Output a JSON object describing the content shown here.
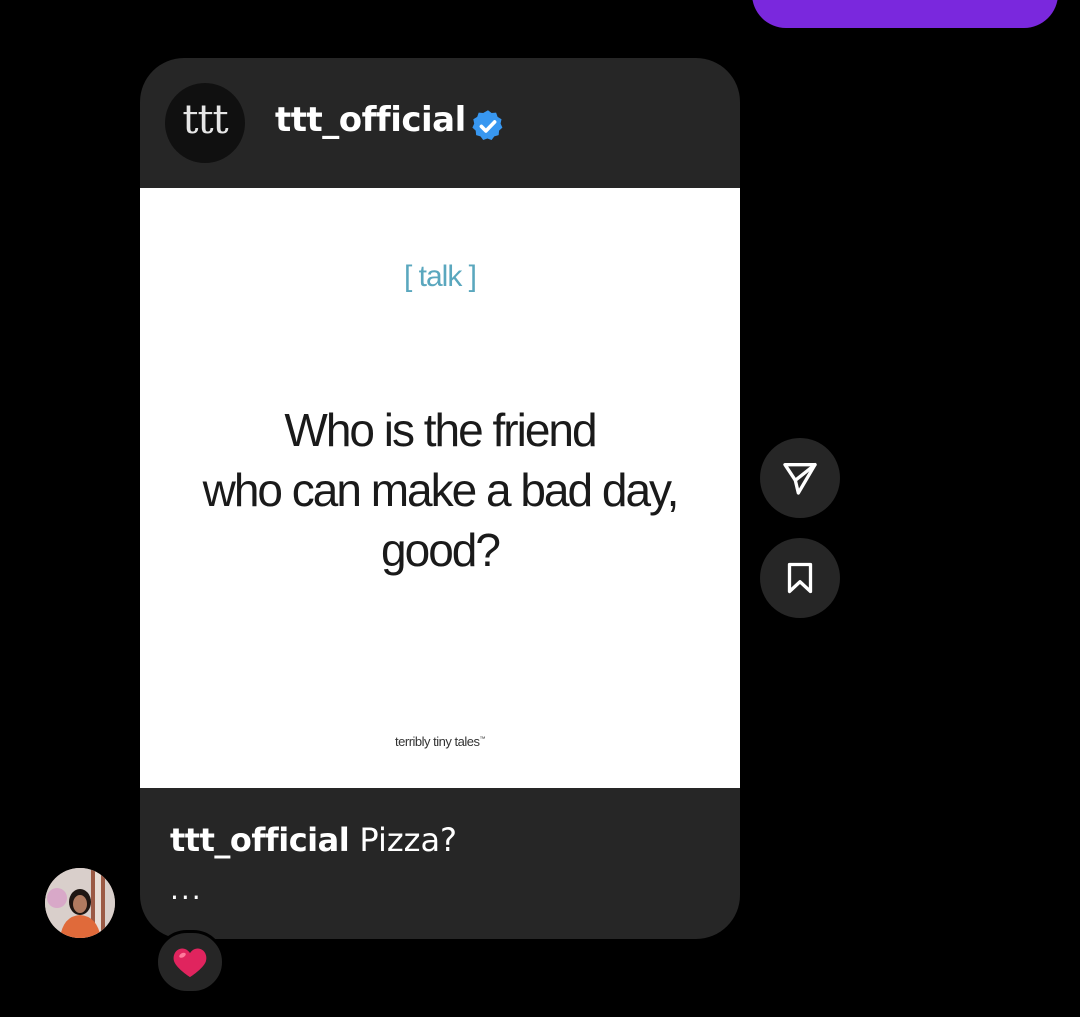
{
  "colors": {
    "background": "#000000",
    "card": "#262626",
    "outgoing_bubble": "#7a28dd",
    "verified": "#3897f0",
    "tag_text": "#5aa7be",
    "heart": "#e0245e"
  },
  "post": {
    "avatar_text": "ttt",
    "username": "ttt_official",
    "verified_icon": "verified-badge-icon",
    "image": {
      "tag": "[ talk ]",
      "quote_line1": "Who is the friend",
      "quote_line2": "who can make a bad day,",
      "quote_line3": "good?",
      "brand": "terribly tiny tales",
      "brand_mark": "™"
    },
    "caption_user": "ttt_official",
    "caption_text": "Pizza?",
    "caption_more": "..."
  },
  "actions": {
    "share_icon": "send-icon",
    "save_icon": "bookmark-icon"
  },
  "reaction": {
    "emoji": "❤️"
  }
}
